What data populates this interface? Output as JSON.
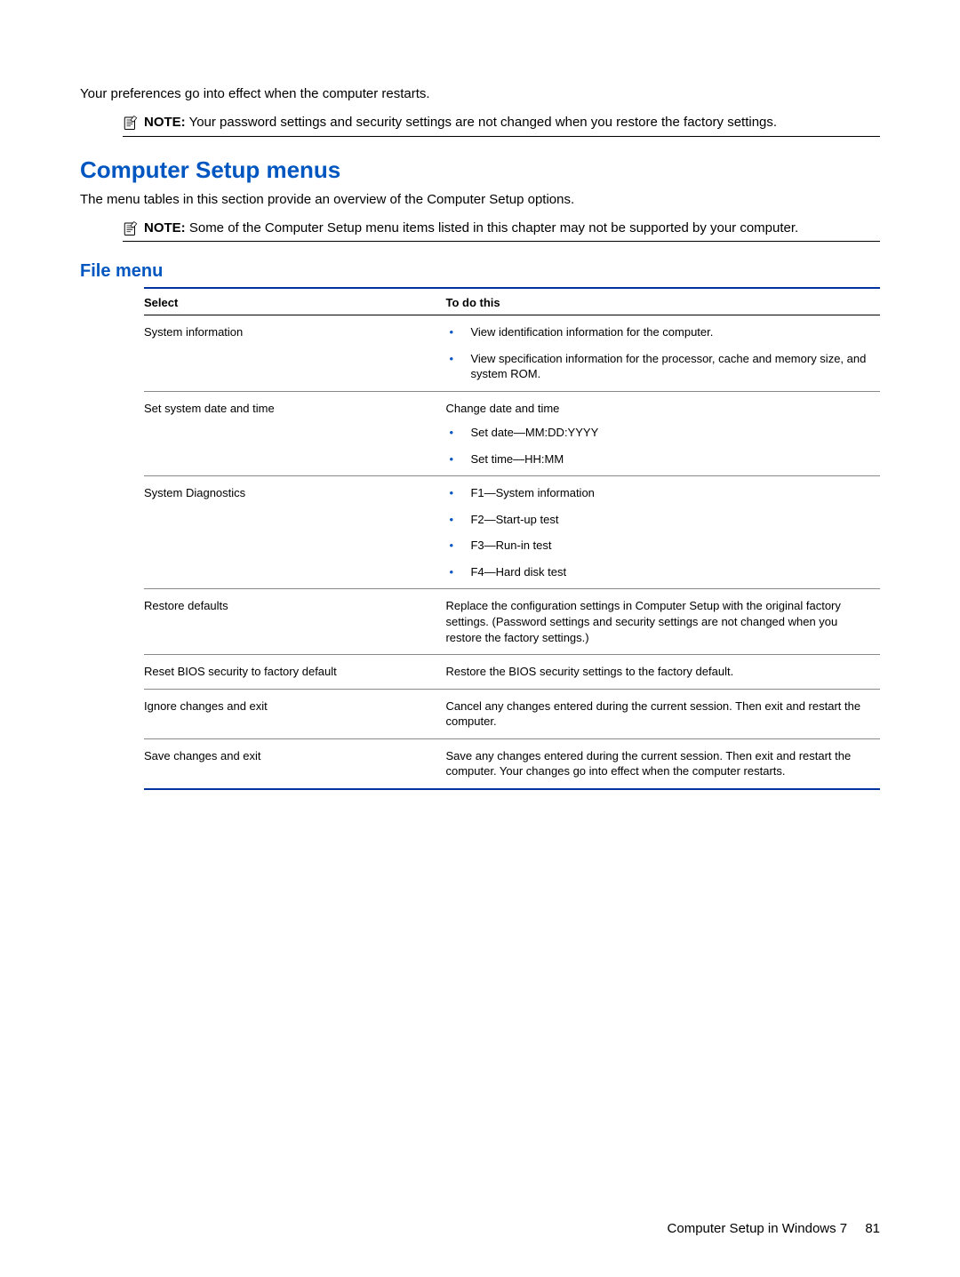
{
  "intro": {
    "preferences_line": "Your preferences go into effect when the computer restarts.",
    "note1_label": "NOTE:",
    "note1_text": "Your password settings and security settings are not changed when you restore the factory settings."
  },
  "section": {
    "heading": "Computer Setup menus",
    "overview": "The menu tables in this section provide an overview of the Computer Setup options.",
    "note2_label": "NOTE:",
    "note2_text": "Some of the Computer Setup menu items listed in this chapter may not be supported by your computer."
  },
  "filemenu": {
    "heading": "File menu",
    "col_select": "Select",
    "col_todo": "To do this",
    "rows": [
      {
        "select": "System information",
        "lead": "",
        "bullets": [
          "View identification information for the computer.",
          "View specification information for the processor, cache and memory size, and system ROM."
        ]
      },
      {
        "select": "Set system date and time",
        "lead": "Change date and time",
        "bullets": [
          "Set date—MM:DD:YYYY",
          "Set time—HH:MM"
        ]
      },
      {
        "select": "System Diagnostics",
        "lead": "",
        "bullets": [
          "F1—System information",
          "F2—Start-up test",
          "F3—Run-in test",
          "F4—Hard disk test"
        ]
      },
      {
        "select": "Restore defaults",
        "lead": "Replace the configuration settings in Computer Setup with the original factory settings. (Password settings and security settings are not changed when you restore the factory settings.)",
        "bullets": []
      },
      {
        "select": "Reset BIOS security to factory default",
        "lead": "Restore the BIOS security settings to the factory default.",
        "bullets": []
      },
      {
        "select": "Ignore changes and exit",
        "lead": "Cancel any changes entered during the current session. Then exit and restart the computer.",
        "bullets": []
      },
      {
        "select": "Save changes and exit",
        "lead": "Save any changes entered during the current session. Then exit and restart the computer. Your changes go into effect when the computer restarts.",
        "bullets": []
      }
    ]
  },
  "footer": {
    "text": "Computer Setup in Windows 7",
    "page": "81"
  }
}
